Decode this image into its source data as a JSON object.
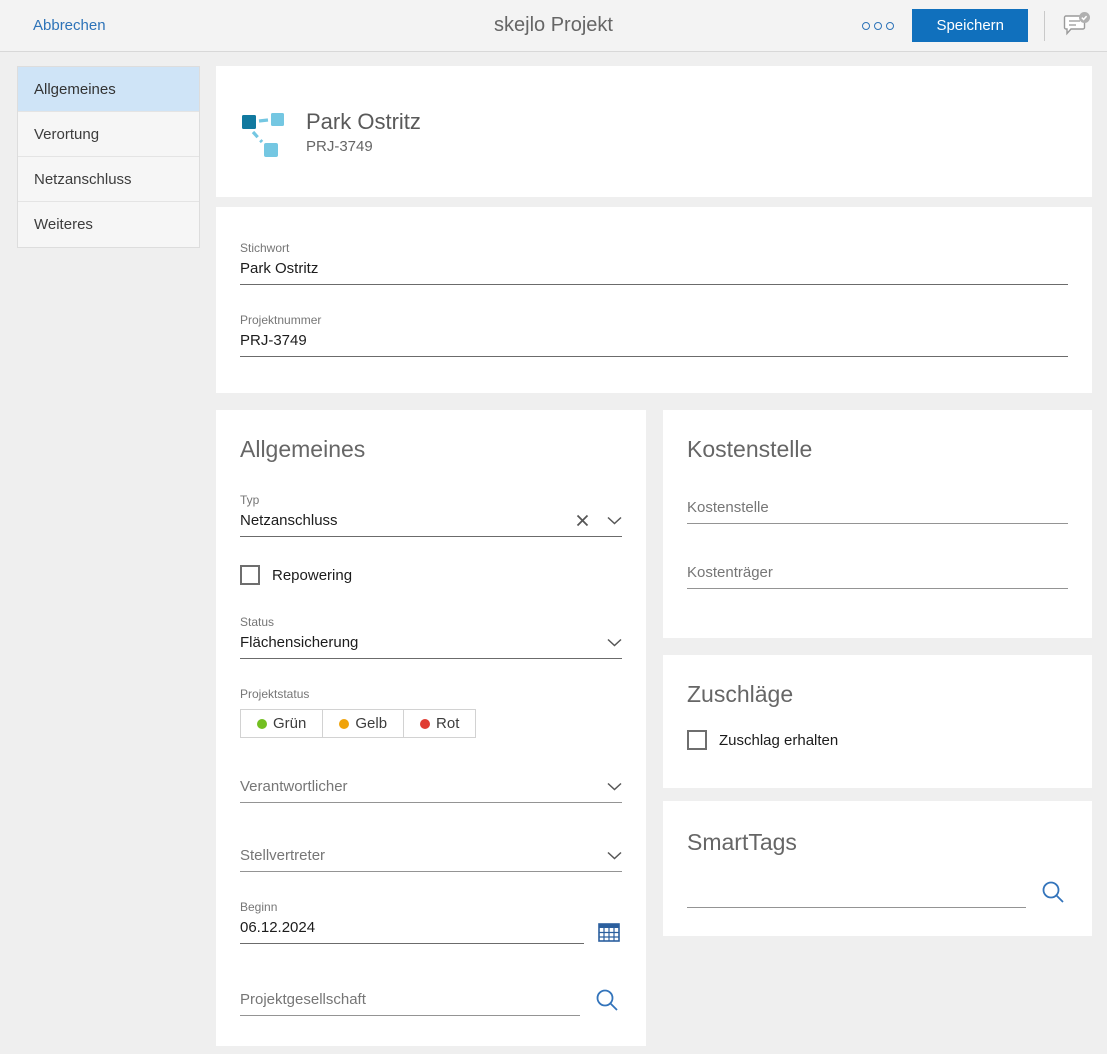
{
  "topbar": {
    "cancel_label": "Abbrechen",
    "title": "skejlo Projekt",
    "save_label": "Speichern"
  },
  "sidebar": {
    "items": [
      {
        "label": "Allgemeines",
        "selected": true
      },
      {
        "label": "Verortung",
        "selected": false
      },
      {
        "label": "Netzanschluss",
        "selected": false
      },
      {
        "label": "Weiteres",
        "selected": false
      }
    ]
  },
  "header": {
    "title": "Park Ostritz",
    "subtitle": "PRJ-3749"
  },
  "base_fields": {
    "stichwort": {
      "label": "Stichwort",
      "value": "Park Ostritz"
    },
    "projektnummer": {
      "label": "Projektnummer",
      "value": "PRJ-3749"
    }
  },
  "allgemeines": {
    "heading": "Allgemeines",
    "typ": {
      "label": "Typ",
      "value": "Netzanschluss"
    },
    "repowering": {
      "label": "Repowering",
      "checked": false
    },
    "status": {
      "label": "Status",
      "value": "Flächensicherung"
    },
    "projektstatus": {
      "label": "Projektstatus",
      "options": [
        {
          "label": "Grün",
          "color": "#73bf21"
        },
        {
          "label": "Gelb",
          "color": "#f0a30a"
        },
        {
          "label": "Rot",
          "color": "#e03c32"
        }
      ]
    },
    "verantwortlicher": {
      "placeholder": "Verantwortlicher",
      "value": ""
    },
    "stellvertreter": {
      "placeholder": "Stellvertreter",
      "value": ""
    },
    "beginn": {
      "label": "Beginn",
      "value": "06.12.2024"
    },
    "projektgesellschaft": {
      "placeholder": "Projektgesellschaft",
      "value": ""
    }
  },
  "kostenstelle": {
    "heading": "Kostenstelle",
    "kostenstelle": {
      "placeholder": "Kostenstelle",
      "value": ""
    },
    "kostentraeger": {
      "placeholder": "Kostenträger",
      "value": ""
    }
  },
  "zuschlaege": {
    "heading": "Zuschläge",
    "zuschlag_erhalten": {
      "label": "Zuschlag erhalten",
      "checked": false
    }
  },
  "smarttags": {
    "heading": "SmartTags",
    "search": {
      "value": ""
    }
  },
  "colors": {
    "accent_blue": "#1070bd",
    "link_blue": "#2d73b8",
    "selected_sidebar": "#cfe4f7",
    "icon_dark_teal": "#11799f",
    "icon_light_blue": "#74c7e2",
    "calendar_blue": "#2b5f9e",
    "search_blue": "#3374bb",
    "status_green": "#73bf21",
    "status_yellow": "#f0a30a",
    "status_red": "#e03c32"
  }
}
